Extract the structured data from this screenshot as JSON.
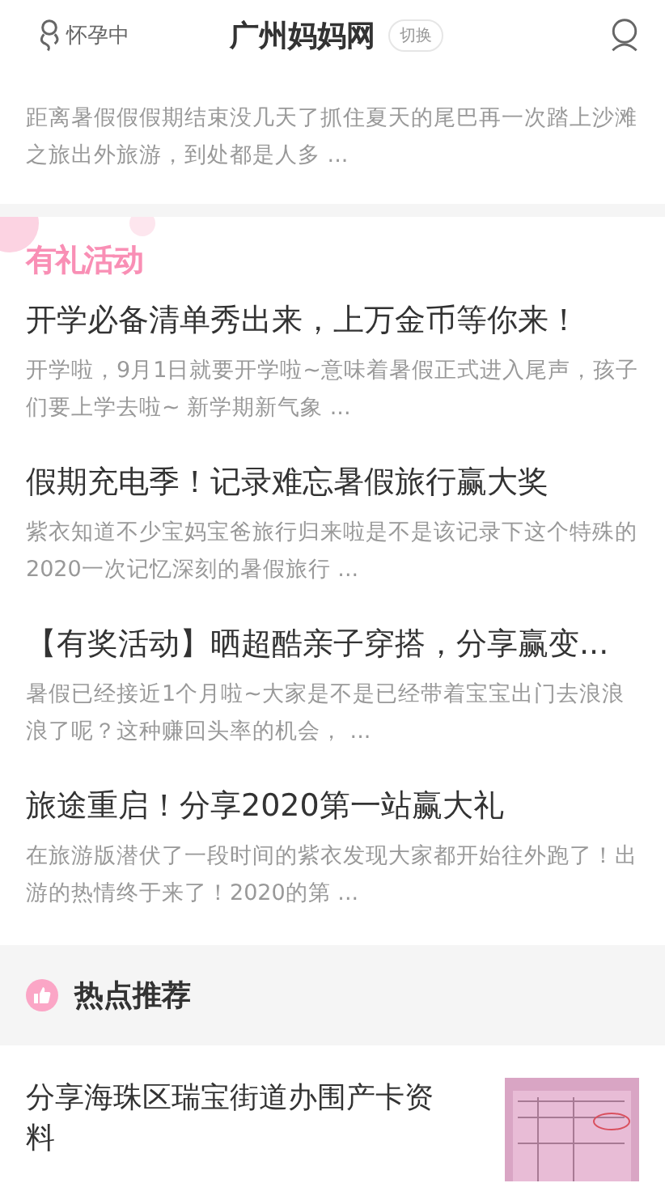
{
  "header": {
    "status": "怀孕中",
    "title": "广州妈妈网",
    "switch_label": "切换"
  },
  "top_article": {
    "summary": "距离暑假假假期结束没几天了抓住夏天的尾巴再一次踏上沙滩之旅出外旅游，到处都是人多 ..."
  },
  "events": {
    "heading": "有礼活动",
    "articles": [
      {
        "title": "开学必备清单秀出来，上万金币等你来！",
        "summary": "开学啦，9月1日就要开学啦~意味着暑假正式进入尾声，孩子们要上学去啦~ 新学期新气象 ..."
      },
      {
        "title": "假期充电季！记录难忘暑假旅行赢大奖",
        "summary": "紫衣知道不少宝妈宝爸旅行归来啦是不是该记录下这个特殊的2020一次记忆深刻的暑假旅行 ..."
      },
      {
        "title": "【有奖活动】晒超酷亲子穿搭，分享赢变...",
        "summary": "暑假已经接近1个月啦~大家是不是已经带着宝宝出门去浪浪浪了呢？这种赚回头率的机会， ..."
      },
      {
        "title": "旅途重启！分享2020第一站赢大礼",
        "summary": "在旅游版潜伏了一段时间的紫衣发现大家都开始往外跑了！出游的热情终于来了！2020的第 ..."
      }
    ]
  },
  "hot": {
    "heading": "热点推荐",
    "articles": [
      {
        "title": "分享海珠区瑞宝街道办围产卡资料",
        "kind": "picture"
      }
    ]
  }
}
